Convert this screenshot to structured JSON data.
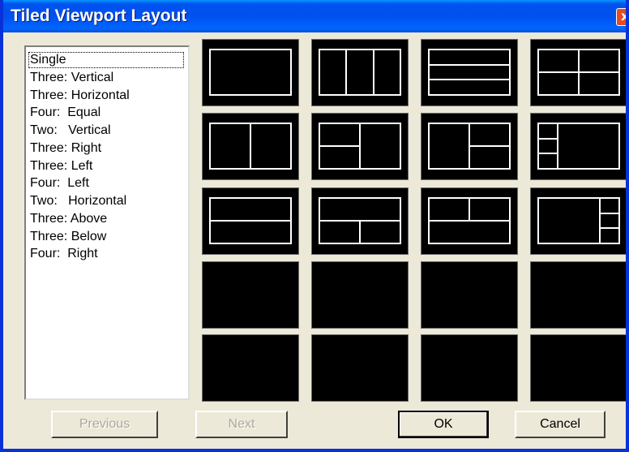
{
  "window": {
    "title": "Tiled Viewport Layout",
    "close_glyph": "x"
  },
  "layouts": [
    "Single",
    "Three: Vertical",
    "Three: Horizontal",
    "Four:  Equal",
    "Two:   Vertical",
    "Three: Right",
    "Three: Left",
    "Four:  Left",
    "Two:   Horizontal",
    "Three: Above",
    "Three: Below",
    "Four:  Right"
  ],
  "selected_layout": "Single",
  "buttons": {
    "previous": "Previous",
    "next": "Next",
    "ok": "OK",
    "cancel": "Cancel"
  },
  "preview_icons": [
    "single-layout-icon",
    "three-vertical-layout-icon",
    "three-horizontal-layout-icon",
    "four-equal-layout-icon",
    "two-vertical-layout-icon",
    "three-right-layout-icon",
    "three-left-layout-icon",
    "four-left-layout-icon",
    "two-horizontal-layout-icon",
    "three-above-layout-icon",
    "three-below-layout-icon",
    "four-right-layout-icon"
  ],
  "colors": {
    "titlebar": "#0054e3",
    "dialog_bg": "#ece9d8",
    "tile_bg": "#000000",
    "tile_lines": "#ffffff"
  }
}
